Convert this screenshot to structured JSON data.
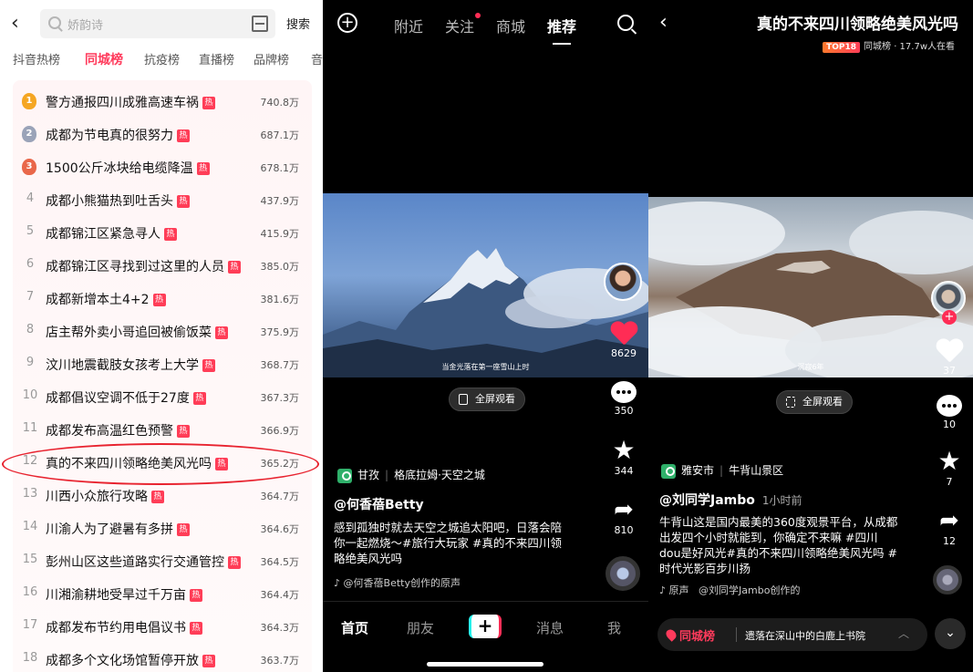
{
  "panel1": {
    "search": {
      "placeholder": "娇韵诗",
      "button": "搜索"
    },
    "tabs": [
      "抖音热榜",
      "同城榜",
      "抗疫榜",
      "直播榜",
      "品牌榜",
      "音"
    ],
    "active_tab": "同城榜",
    "rows": [
      {
        "rank": "1",
        "title": "警方通报四川成雅高速车祸",
        "count": "740.8万"
      },
      {
        "rank": "2",
        "title": "成都为节电真的很努力",
        "count": "687.1万"
      },
      {
        "rank": "3",
        "title": "1500公斤冰块给电缆降温",
        "count": "678.1万"
      },
      {
        "rank": "4",
        "title": "成都小熊猫热到吐舌头",
        "count": "437.9万"
      },
      {
        "rank": "5",
        "title": "成都锦江区紧急寻人",
        "count": "415.9万"
      },
      {
        "rank": "6",
        "title": "成都锦江区寻找到过这里的人员",
        "count": "385.0万"
      },
      {
        "rank": "7",
        "title": "成都新增本土4+2",
        "count": "381.6万"
      },
      {
        "rank": "8",
        "title": "店主帮外卖小哥追回被偷饭菜",
        "count": "375.9万"
      },
      {
        "rank": "9",
        "title": "汶川地震截肢女孩考上大学",
        "count": "368.7万"
      },
      {
        "rank": "10",
        "title": "成都倡议空调不低于27度",
        "count": "367.3万"
      },
      {
        "rank": "11",
        "title": "成都发布高温红色预警",
        "count": "366.9万"
      },
      {
        "rank": "12",
        "title": "真的不来四川领略绝美风光吗",
        "count": "365.2万"
      },
      {
        "rank": "13",
        "title": "川西小众旅行攻略",
        "count": "364.7万"
      },
      {
        "rank": "14",
        "title": "川渝人为了避暑有多拼",
        "count": "364.6万"
      },
      {
        "rank": "15",
        "title": "彭州山区这些道路实行交通管控",
        "count": "364.5万"
      },
      {
        "rank": "16",
        "title": "川湘渝耕地受旱过千万亩",
        "count": "364.4万"
      },
      {
        "rank": "17",
        "title": "成都发布节约用电倡议书",
        "count": "364.3万"
      },
      {
        "rank": "18",
        "title": "成都多个文化场馆暂停开放",
        "count": "363.7万"
      }
    ],
    "hot_label": "热"
  },
  "panel2": {
    "nav": [
      "附近",
      "关注",
      "商城",
      "推荐"
    ],
    "active_nav": "推荐",
    "video_caption": "当金光落在第一座雪山上时",
    "fullscreen": "全屏观看",
    "likes": "8629",
    "comments": "350",
    "favorites": "344",
    "shares": "810",
    "location": "甘孜",
    "place": "格底拉姆·天空之城",
    "author": "@何香蓓Betty",
    "description": "感到孤独时就去天空之城追太阳吧，日落会陪你一起燃烧～#旅行大玩家 #真的不来四川领略绝美风光吗",
    "music": "@何香蓓Betty创作的原声",
    "bottom_nav": [
      "首页",
      "朋友",
      "消息",
      "我"
    ],
    "plus": "+",
    "colors": {
      "like": "#ff2c55",
      "accent": "#25f4ee"
    }
  },
  "panel3": {
    "title": "真的不来四川领略绝美风光吗",
    "rank_badge": "TOP18",
    "subtitle": "同城榜 · 17.7w人在看",
    "video_caption": "沉寂6年",
    "fullscreen": "全屏观看",
    "likes": "37",
    "comments": "10",
    "favorites": "7",
    "shares": "12",
    "location": "雅安市",
    "place": "牛背山景区",
    "author": "@刘同学Jambo",
    "time": "1小时前",
    "description": "牛背山这是国内最美的360度观景平台，从成都出发四个小时就能到，你确定不来嘛 #四川dou是好风光#真的不来四川领略绝美风光吗 #时代光影百步川扬",
    "music_prefix": "原声",
    "music": "@刘同学Jambo创作的",
    "bottom_tag": "同城榜",
    "bottom_text": "遗落在深山中的白鹿上书院"
  }
}
